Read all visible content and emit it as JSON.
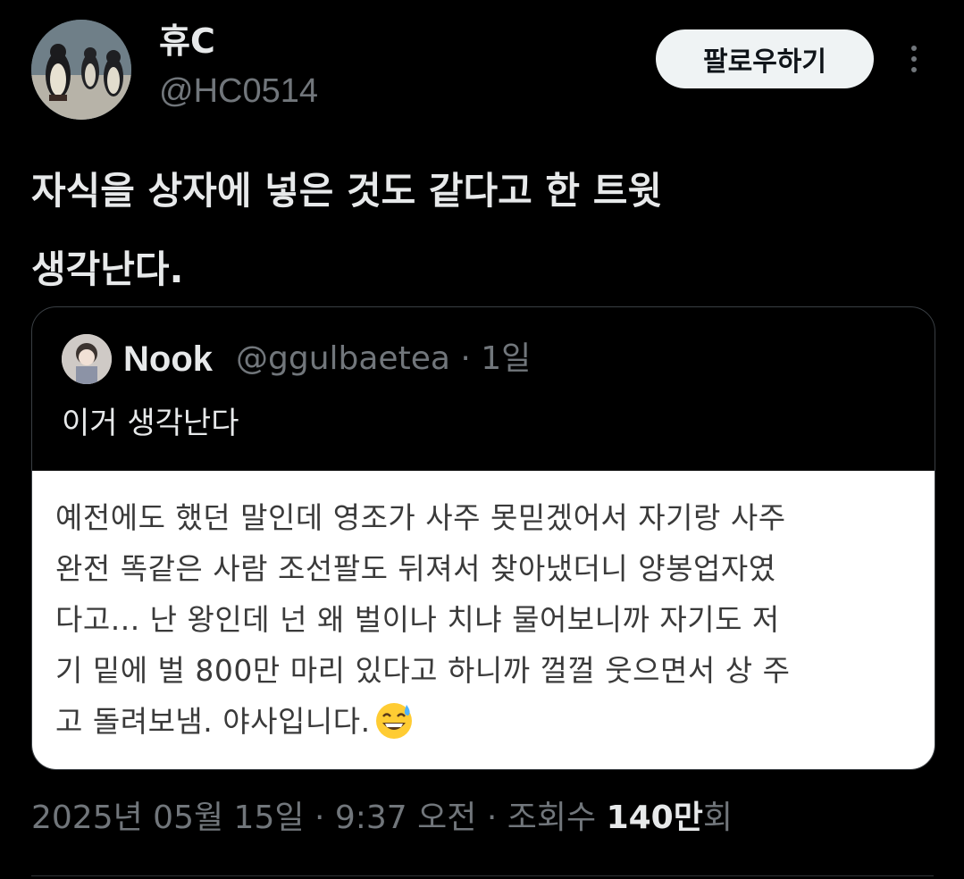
{
  "author": {
    "name": "휴C",
    "handle": "@HC0514"
  },
  "header": {
    "follow_label": "팔로우하기",
    "more_icon": "more-vertical-icon"
  },
  "tweet": {
    "text_line1": "자식을 상자에 넣은 것도 같다고 한 트윗",
    "text_line2": "생각난다."
  },
  "quote": {
    "name": "Nook",
    "handle": "@ggulbaetea",
    "separator": "·",
    "time": "1일",
    "text": "이거 생각난다",
    "image_lines": [
      "예전에도 했던 말인데 영조가 사주 못믿겠어서 자기랑 사주",
      "완전 똑같은 사람 조선팔도 뒤져서 찾아냈더니 양봉업자였",
      "다고... 난 왕인데 넌 왜 벌이나 치냐 물어보니까 자기도 저",
      "기 밑에 벌 800만 마리 있다고 하니까 껄껄 웃으면서 상 주",
      "고 돌려보냄. 야사입니다."
    ],
    "image_emoji": "grinning-face-with-sweat-emoji"
  },
  "meta": {
    "date": "2025년 05월 15일",
    "dot1": "·",
    "time": "9:37 오전",
    "dot2": "·",
    "views_label": "조회수",
    "views_count": "140만",
    "views_suffix": "회"
  },
  "colors": {
    "background": "#000000",
    "text_primary": "#e7e9ea",
    "text_secondary": "#71767b",
    "follow_bg": "#eff3f4",
    "border": "#3a3f44"
  }
}
